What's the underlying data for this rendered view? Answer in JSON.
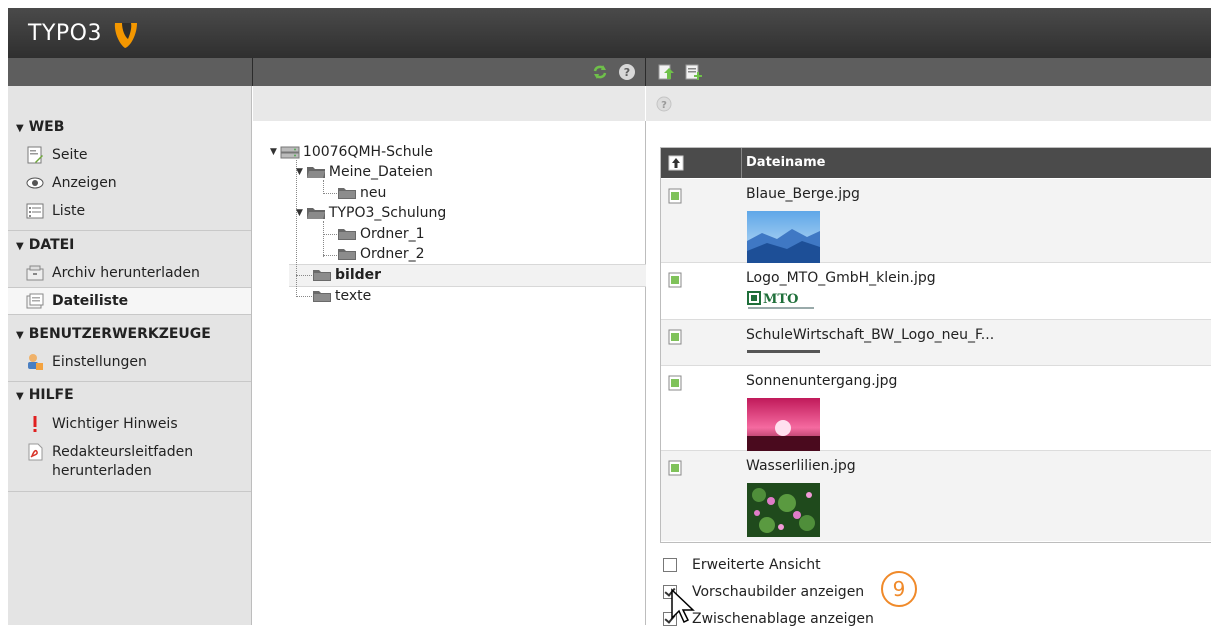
{
  "app": {
    "logo_text": "TYPO3"
  },
  "toolbar": {
    "refresh_icon": "refresh-icon",
    "help_icon": "help-icon",
    "upload_icon": "upload-icon",
    "new_icon": "new-file-icon"
  },
  "menu": {
    "groups": [
      {
        "label": "WEB",
        "items": [
          {
            "label": "Seite",
            "icon": "page-icon"
          },
          {
            "label": "Anzeigen",
            "icon": "eye-icon"
          },
          {
            "label": "Liste",
            "icon": "list-icon"
          }
        ]
      },
      {
        "label": "DATEI",
        "items": [
          {
            "label": "Archiv herunterladen",
            "icon": "archive-icon"
          },
          {
            "label": "Dateiliste",
            "icon": "filelist-icon",
            "active": true
          }
        ]
      },
      {
        "label": "BENUTZERWERKZEUGE",
        "items": [
          {
            "label": "Einstellungen",
            "icon": "user-settings-icon"
          }
        ]
      },
      {
        "label": "HILFE",
        "items": [
          {
            "label": "Wichtiger Hinweis",
            "icon": "exclamation-icon"
          },
          {
            "label": "Redakteursleitfaden",
            "label2": "herunterladen",
            "icon": "pdf-icon"
          }
        ]
      }
    ]
  },
  "tree": {
    "root": "10076QMH-Schule",
    "nodes": [
      "Meine_Dateien",
      "neu",
      "TYPO3_Schulung",
      "Ordner_1",
      "Ordner_2",
      "bilder",
      "texte"
    ],
    "selected": "bilder"
  },
  "files": {
    "header_name": "Dateiname",
    "rows": [
      {
        "name": "Blaue_Berge.jpg"
      },
      {
        "name": "Logo_MTO_GmbH_klein.jpg"
      },
      {
        "name": "SchuleWirtschaft_BW_Logo_neu_F..."
      },
      {
        "name": "Sonnenuntergang.jpg"
      },
      {
        "name": "Wasserlilien.jpg"
      }
    ]
  },
  "options": {
    "extended_view": {
      "label": "Erweiterte Ansicht",
      "checked": false
    },
    "thumbnails": {
      "label": "Vorschaubilder anzeigen",
      "checked": true
    },
    "clipboard": {
      "label": "Zwischenablage anzeigen",
      "checked": true
    }
  },
  "annotation": {
    "step": "9"
  }
}
